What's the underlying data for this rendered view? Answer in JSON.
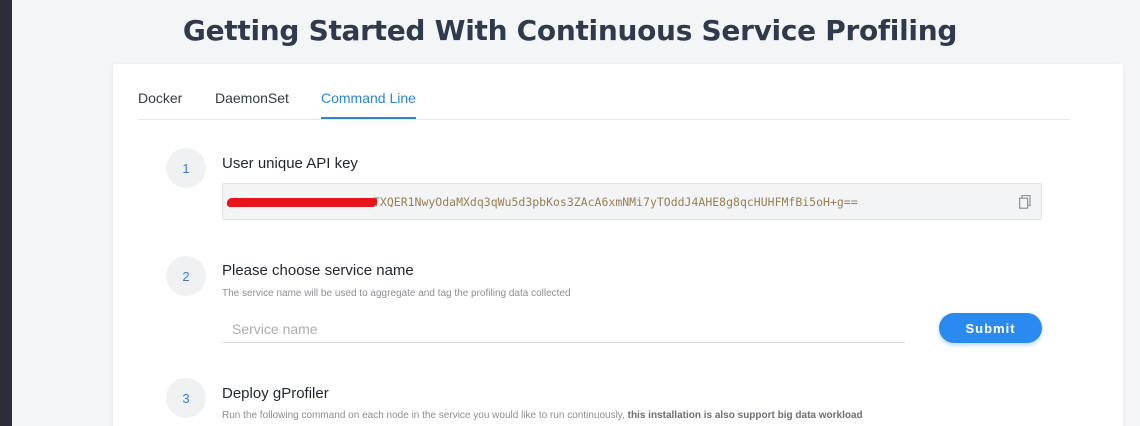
{
  "page": {
    "title": "Getting Started With Continuous Service Profiling"
  },
  "tabs": [
    {
      "label": "Docker",
      "active": false
    },
    {
      "label": "DaemonSet",
      "active": false
    },
    {
      "label": "Command Line",
      "active": true
    }
  ],
  "steps": [
    {
      "number": "1",
      "title": "User unique API key",
      "api_key_visible": "TXQER1NwyOdaMXdq3qWu5d3pbKos3ZAcA6xmNMi7yTOddJ4AHE8g8qcHUHFMfBi5oH+g=="
    },
    {
      "number": "2",
      "title": "Please choose service name",
      "description": "The service name will be used to aggregate and tag the profiling data collected",
      "input_placeholder": "Service name",
      "input_value": "",
      "submit_label": "Submit"
    },
    {
      "number": "3",
      "title": "Deploy gProfiler",
      "description": "Run the following command on each node in the service you would like to run continuously,",
      "description_bold": "this installation is also support big data workload"
    }
  ],
  "colors": {
    "accent": "#2b84d8",
    "submit_bg": "#2b8af0",
    "title": "#2f3b4c",
    "redaction": "#e8141b",
    "api_text": "#9a7f52"
  },
  "icons": {
    "copy": "copy-icon"
  }
}
